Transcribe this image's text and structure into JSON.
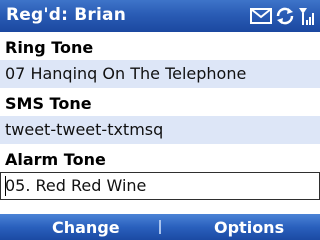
{
  "titlebar": {
    "title": "Reg'd: Brian",
    "icons": [
      "envelope-icon",
      "sync-icon",
      "signal-strength-icon"
    ]
  },
  "fields": [
    {
      "label": "Ring Tone",
      "value": "07  Hanqinq On The Telephone"
    },
    {
      "label": "SMS Tone",
      "value": "tweet-tweet-txtmsq"
    },
    {
      "label": "Alarm Tone",
      "value": "05. Red Red Wine"
    }
  ],
  "softkeys": {
    "left": "Change",
    "right": "Options"
  },
  "colors": {
    "bar_blue": "#2a5cb5",
    "field_bg": "#dde6f7"
  }
}
